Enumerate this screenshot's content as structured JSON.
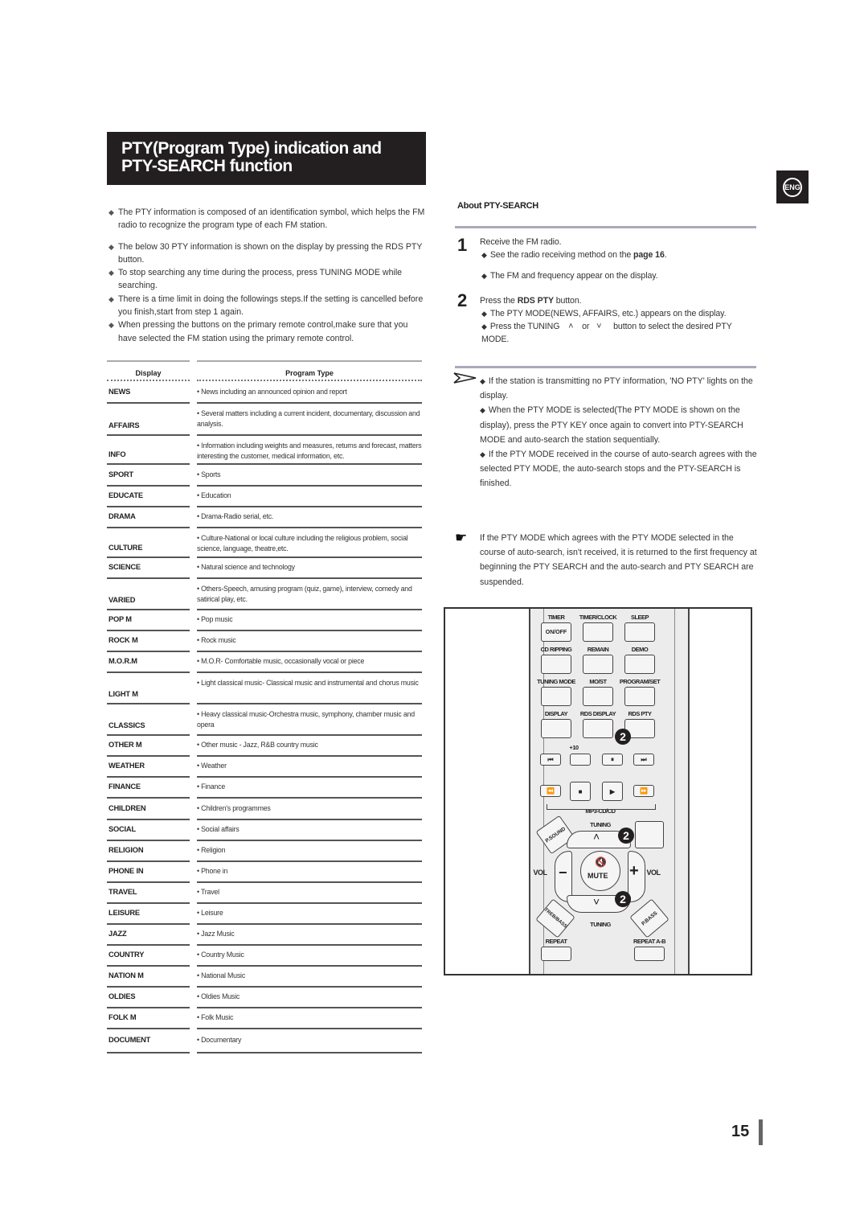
{
  "title": {
    "line1": "PTY(Program Type) indication and",
    "line2": "PTY-SEARCH function"
  },
  "language_badge": "ENG",
  "intro_bullets": [
    "The PTY information is composed of an identification symbol, which helps the FM radio to recognize the program type of each FM station.",
    "The below 30 PTY information is shown on the display by pressing the RDS PTY button.",
    "To stop searching any time during the process, press TUNING MODE while searching.",
    "There is a time limit in doing the followings steps.If the setting is cancelled before you finish,start from step 1 again.",
    "When pressing the buttons on the primary remote control,make sure that you have selected the FM station using the primary remote control."
  ],
  "table": {
    "headers": {
      "display": "Display",
      "program_type": "Program Type"
    },
    "rows": [
      {
        "code": "NEWS",
        "desc": "• News including an announced opinion and report"
      },
      {
        "code": "AFFAIRS",
        "desc": "• Several matters including a current incident, documentary, discussion and analysis."
      },
      {
        "code": "INFO",
        "desc": "• Information including weights and measures, returns and forecast, matters interesting the customer, medical information, etc."
      },
      {
        "code": "SPORT",
        "desc": "• Sports"
      },
      {
        "code": "EDUCATE",
        "desc": "• Education"
      },
      {
        "code": "DRAMA",
        "desc": "• Drama-Radio serial, etc."
      },
      {
        "code": "CULTURE",
        "desc": "• Culture-National or local culture including the religious problem, social science, language, theatre,etc."
      },
      {
        "code": "SCIENCE",
        "desc": "• Natural science and technology"
      },
      {
        "code": "VARIED",
        "desc": "• Others-Speech, amusing program (quiz, game), interview, comedy and satirical play, etc."
      },
      {
        "code": "POP M",
        "desc": "• Pop music"
      },
      {
        "code": "ROCK M",
        "desc": "• Rock music"
      },
      {
        "code": "M.O.R.M",
        "desc": "• M.O.R- Comfortable music, occasionally vocal or piece"
      },
      {
        "code": "LIGHT M",
        "desc": "• Light classical music- Classical music and instrumental and chorus music"
      },
      {
        "code": "CLASSICS",
        "desc": "• Heavy classical music-Orchestra music, symphony, chamber music and opera"
      },
      {
        "code": "OTHER M",
        "desc": "• Other music - Jazz, R&B country music"
      },
      {
        "code": "WEATHER",
        "desc": "• Weather"
      },
      {
        "code": "FINANCE",
        "desc": "• Finance"
      },
      {
        "code": "CHILDREN",
        "desc": "• Children's programmes"
      },
      {
        "code": "SOCIAL",
        "desc": "• Social affairs"
      },
      {
        "code": "RELIGION",
        "desc": "• Religion"
      },
      {
        "code": "PHONE IN",
        "desc": "• Phone in"
      },
      {
        "code": "TRAVEL",
        "desc": "• Travel"
      },
      {
        "code": "LEISURE",
        "desc": "• Leisure"
      },
      {
        "code": "JAZZ",
        "desc": "• Jazz Music"
      },
      {
        "code": "COUNTRY",
        "desc": "• Country Music"
      },
      {
        "code": "NATION M",
        "desc": "• National Music"
      },
      {
        "code": "OLDIES",
        "desc": "• Oldies Music"
      },
      {
        "code": "FOLK M",
        "desc": "• Folk Music"
      },
      {
        "code": "DOCUMENT",
        "desc": "• Documentary"
      }
    ]
  },
  "about": {
    "heading": "About PTY-SEARCH",
    "steps": [
      {
        "num": "1",
        "text": "Receive the FM radio.",
        "subs": [
          {
            "pre": "See the radio receiving method on the ",
            "bold": "page 16",
            "post": "."
          },
          {
            "pre": "The FM and frequency appear on the display.",
            "bold": "",
            "post": ""
          }
        ]
      },
      {
        "num": "2",
        "text_pre": "Press the ",
        "text_bold": "RDS PTY",
        "text_post": " button.",
        "subs": [
          {
            "pre": "The PTY MODE(NEWS, AFFAIRS, etc.) appears on the display.",
            "bold": "",
            "post": ""
          },
          {
            "pre": "Press the TUNING",
            "mid": "or",
            "post": "button to select the desired PTY MODE."
          }
        ]
      }
    ]
  },
  "notes": [
    "If the station is transmitting no PTY information, 'NO PTY' lights on the display.",
    "When the PTY MODE is selected(The PTY MODE is shown on the display), press the PTY KEY once again to convert into PTY-SEARCH MODE and auto-search the station sequentially.",
    "If the PTY MODE received in the course of auto-search agrees with the selected PTY MODE, the auto-search stops and the PTY-SEARCH is finished."
  ],
  "hand_note": "If the PTY MODE which agrees with the PTY MODE selected in the course of auto-search, isn't received, it is returned to the first frequency at beginning the PTY SEARCH and the auto-search and PTY SEARCH are suspended.",
  "remote": {
    "row1_labels": [
      "TIMER",
      "TIMER/CLOCK",
      "SLEEP"
    ],
    "row1_btn": "ON/OFF",
    "row2_labels": [
      "CD RIPPING",
      "REMAIN",
      "DEMO"
    ],
    "row3_labels": [
      "TUNING MODE",
      "MO/ST",
      "PROGRAM/SET"
    ],
    "row4_labels": [
      "DISPLAY",
      "RDS DISPLAY",
      "RDS PTY"
    ],
    "plus10": "+10",
    "transport1": [
      "⏮",
      "",
      "⏸",
      "⏭"
    ],
    "transport2": [
      "⏪",
      "■",
      "▶",
      "⏩"
    ],
    "mp3_label": "MP3-CD/CD",
    "psound": "P.SOUND",
    "tuning_up_label": "TUNING",
    "tuning_down_label": "TUNING",
    "vol_left": "VOL",
    "vol_right": "VOL",
    "minus": "−",
    "plus": "+",
    "mute": "MUTE",
    "treb_bass": "TREB/BASS",
    "pbass": "P.BASS",
    "repeat": "REPEAT",
    "repeat_ab": "REPEAT A-B",
    "callout": "2"
  },
  "page_number": "15"
}
